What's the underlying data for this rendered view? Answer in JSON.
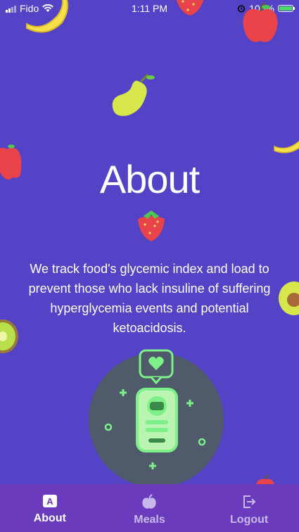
{
  "status_bar": {
    "carrier": "Fido",
    "time": "1:11 PM",
    "battery": "100%",
    "icons": [
      "signal-bars-icon",
      "wifi-icon",
      "alarm-icon",
      "battery-icon"
    ]
  },
  "about": {
    "title": "About",
    "description": "We track food's glycemic index and load to prevent those who lack insuline of suffering hyperglycemia events and potential ketoacidosis."
  },
  "tabs": [
    {
      "label": "About",
      "icon": "about-a-icon",
      "active": true
    },
    {
      "label": "Meals",
      "icon": "apple-icon",
      "active": false
    },
    {
      "label": "Logout",
      "icon": "logout-icon",
      "active": false
    }
  ],
  "colors": {
    "background": "#5443c6",
    "tab_bar": "#6a3bbd",
    "illustration_circle": "#4f5a6a",
    "illustration_accent": "#7ef08a"
  }
}
